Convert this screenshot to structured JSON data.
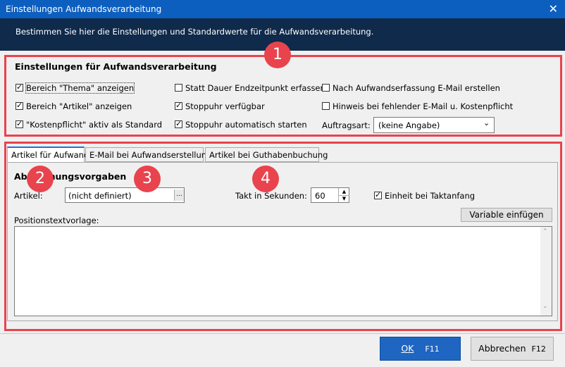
{
  "window": {
    "title": "Einstellungen Aufwandsverarbeitung",
    "close_glyph": "✕"
  },
  "header": {
    "description": "Bestimmen Sie hier die Einstellungen und Standardwerte für die Aufwandsverarbeitung."
  },
  "settings": {
    "heading": "Einstellungen für Aufwandsverarbeitung",
    "col1": [
      {
        "label": "Bereich \"Thema\" anzeigen",
        "checked": true
      },
      {
        "label": "Bereich \"Artikel\" anzeigen",
        "checked": true
      },
      {
        "label": "\"Kostenpflicht\" aktiv als Standard",
        "checked": true
      }
    ],
    "col2": [
      {
        "label": "Statt Dauer Endzeitpunkt erfassen",
        "checked": false
      },
      {
        "label": "Stoppuhr verfügbar",
        "checked": true
      },
      {
        "label": "Stoppuhr automatisch starten",
        "checked": true
      }
    ],
    "col3": [
      {
        "label": "Nach Aufwandserfassung E-Mail erstellen",
        "checked": false
      },
      {
        "label": "Hinweis bei fehlender E-Mail u. Kostenpflicht",
        "checked": false
      }
    ],
    "auftragsart_label": "Auftragsart:",
    "auftragsart_value": "(keine Angabe)"
  },
  "badges": {
    "b1": "1",
    "b2": "2",
    "b3": "3",
    "b4": "4"
  },
  "tabs": [
    {
      "label": "Artikel für Aufwand",
      "active": true
    },
    {
      "label": "E-Mail bei Aufwandserstellung",
      "active": false
    },
    {
      "label": "Artikel bei Guthabenbuchung",
      "active": false
    }
  ],
  "tab_content": {
    "heading": "Abrechnungsvorgaben",
    "artikel_label": "Artikel:",
    "artikel_value": "(nicht definiert)",
    "browse_glyph": "...",
    "takt_label": "Takt in Sekunden:",
    "takt_value": "60",
    "einheit_label": "Einheit bei Taktanfang",
    "einheit_checked": true,
    "positionstext_label": "Positionstextvorlage:",
    "variable_button": "Variable einfügen",
    "positionstext_value": ""
  },
  "footer": {
    "ok_label": "OK",
    "ok_shortcut": "F11",
    "cancel_label": "Abbrechen",
    "cancel_shortcut": "F12"
  },
  "colors": {
    "accent": "#1a73e8",
    "highlight": "#e9434e",
    "header_bg": "#0f2a4a",
    "titlebar_bg": "#0d5fbf"
  }
}
